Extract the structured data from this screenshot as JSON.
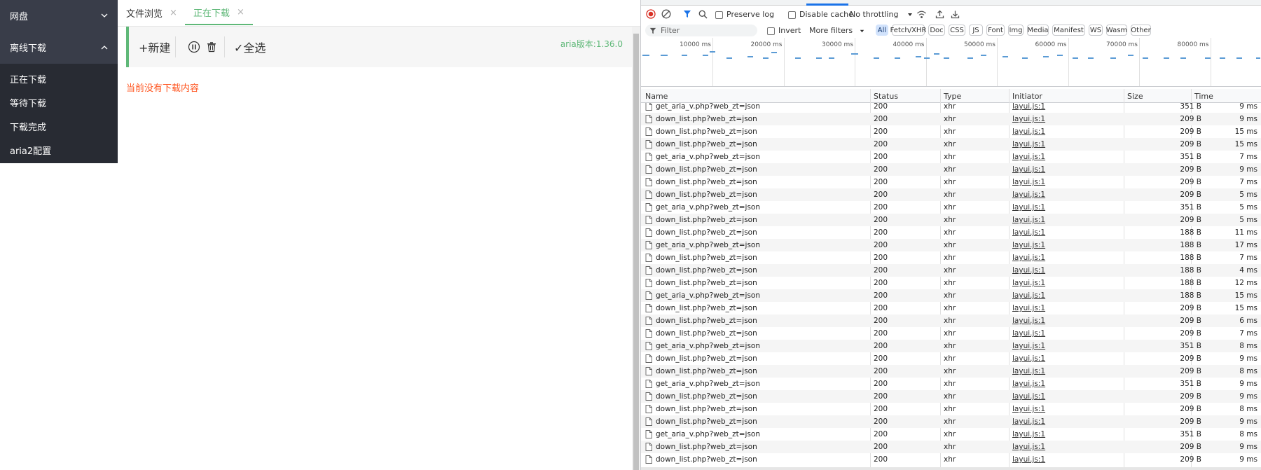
{
  "sidebar": {
    "items": [
      {
        "label": "网盘"
      },
      {
        "label": "离线下载"
      }
    ],
    "children": [
      {
        "label": "正在下载"
      },
      {
        "label": "等待下载"
      },
      {
        "label": "下载完成"
      },
      {
        "label": "aria2配置"
      }
    ]
  },
  "main": {
    "tabs": [
      {
        "label": "文件浏览",
        "close": "×"
      },
      {
        "label": "正在下载",
        "close": "×"
      }
    ],
    "toolbar": {
      "new_label": "+新建",
      "select_all_label": "✓全选",
      "aria_version": "aria版本:1.36.0"
    },
    "empty_message": "当前没有下载内容"
  },
  "devtools": {
    "preserve_log": "Preserve log",
    "disable_cache": "Disable cache",
    "throttling": "No throttling",
    "filter_placeholder": "Filter",
    "invert": "Invert",
    "more_filters": "More filters",
    "filter_types": [
      "All",
      "Fetch/XHR",
      "Doc",
      "CSS",
      "JS",
      "Font",
      "Img",
      "Media",
      "Manifest",
      "WS",
      "Wasm",
      "Other"
    ],
    "overview_ticks": [
      "10000 ms",
      "20000 ms",
      "30000 ms",
      "40000 ms",
      "50000 ms",
      "60000 ms",
      "70000 ms",
      "80000 ms"
    ],
    "columns": [
      "Name",
      "Status",
      "Type",
      "Initiator",
      "Size",
      "Time"
    ],
    "rows": [
      {
        "name": "get_aria_v.php?web_zt=json",
        "status": "200",
        "type": "xhr",
        "initiator": "layui.js:1",
        "size": "351 B",
        "time": "9 ms"
      },
      {
        "name": "down_list.php?web_zt=json",
        "status": "200",
        "type": "xhr",
        "initiator": "layui.js:1",
        "size": "209 B",
        "time": "9 ms"
      },
      {
        "name": "down_list.php?web_zt=json",
        "status": "200",
        "type": "xhr",
        "initiator": "layui.js:1",
        "size": "209 B",
        "time": "15 ms"
      },
      {
        "name": "down_list.php?web_zt=json",
        "status": "200",
        "type": "xhr",
        "initiator": "layui.js:1",
        "size": "209 B",
        "time": "15 ms"
      },
      {
        "name": "get_aria_v.php?web_zt=json",
        "status": "200",
        "type": "xhr",
        "initiator": "layui.js:1",
        "size": "351 B",
        "time": "7 ms"
      },
      {
        "name": "down_list.php?web_zt=json",
        "status": "200",
        "type": "xhr",
        "initiator": "layui.js:1",
        "size": "209 B",
        "time": "9 ms"
      },
      {
        "name": "down_list.php?web_zt=json",
        "status": "200",
        "type": "xhr",
        "initiator": "layui.js:1",
        "size": "209 B",
        "time": "7 ms"
      },
      {
        "name": "down_list.php?web_zt=json",
        "status": "200",
        "type": "xhr",
        "initiator": "layui.js:1",
        "size": "209 B",
        "time": "5 ms"
      },
      {
        "name": "get_aria_v.php?web_zt=json",
        "status": "200",
        "type": "xhr",
        "initiator": "layui.js:1",
        "size": "351 B",
        "time": "5 ms"
      },
      {
        "name": "down_list.php?web_zt=json",
        "status": "200",
        "type": "xhr",
        "initiator": "layui.js:1",
        "size": "209 B",
        "time": "5 ms"
      },
      {
        "name": "down_list.php?web_zt=json",
        "status": "200",
        "type": "xhr",
        "initiator": "layui.js:1",
        "size": "188 B",
        "time": "11 ms"
      },
      {
        "name": "get_aria_v.php?web_zt=json",
        "status": "200",
        "type": "xhr",
        "initiator": "layui.js:1",
        "size": "188 B",
        "time": "17 ms"
      },
      {
        "name": "down_list.php?web_zt=json",
        "status": "200",
        "type": "xhr",
        "initiator": "layui.js:1",
        "size": "188 B",
        "time": "7 ms"
      },
      {
        "name": "down_list.php?web_zt=json",
        "status": "200",
        "type": "xhr",
        "initiator": "layui.js:1",
        "size": "188 B",
        "time": "4 ms"
      },
      {
        "name": "down_list.php?web_zt=json",
        "status": "200",
        "type": "xhr",
        "initiator": "layui.js:1",
        "size": "188 B",
        "time": "12 ms"
      },
      {
        "name": "get_aria_v.php?web_zt=json",
        "status": "200",
        "type": "xhr",
        "initiator": "layui.js:1",
        "size": "188 B",
        "time": "15 ms"
      },
      {
        "name": "down_list.php?web_zt=json",
        "status": "200",
        "type": "xhr",
        "initiator": "layui.js:1",
        "size": "209 B",
        "time": "15 ms"
      },
      {
        "name": "down_list.php?web_zt=json",
        "status": "200",
        "type": "xhr",
        "initiator": "layui.js:1",
        "size": "209 B",
        "time": "6 ms"
      },
      {
        "name": "down_list.php?web_zt=json",
        "status": "200",
        "type": "xhr",
        "initiator": "layui.js:1",
        "size": "209 B",
        "time": "7 ms"
      },
      {
        "name": "get_aria_v.php?web_zt=json",
        "status": "200",
        "type": "xhr",
        "initiator": "layui.js:1",
        "size": "351 B",
        "time": "8 ms"
      },
      {
        "name": "down_list.php?web_zt=json",
        "status": "200",
        "type": "xhr",
        "initiator": "layui.js:1",
        "size": "209 B",
        "time": "9 ms"
      },
      {
        "name": "down_list.php?web_zt=json",
        "status": "200",
        "type": "xhr",
        "initiator": "layui.js:1",
        "size": "209 B",
        "time": "8 ms"
      },
      {
        "name": "get_aria_v.php?web_zt=json",
        "status": "200",
        "type": "xhr",
        "initiator": "layui.js:1",
        "size": "351 B",
        "time": "9 ms"
      },
      {
        "name": "down_list.php?web_zt=json",
        "status": "200",
        "type": "xhr",
        "initiator": "layui.js:1",
        "size": "209 B",
        "time": "9 ms"
      },
      {
        "name": "down_list.php?web_zt=json",
        "status": "200",
        "type": "xhr",
        "initiator": "layui.js:1",
        "size": "209 B",
        "time": "8 ms"
      },
      {
        "name": "down_list.php?web_zt=json",
        "status": "200",
        "type": "xhr",
        "initiator": "layui.js:1",
        "size": "209 B",
        "time": "9 ms"
      },
      {
        "name": "get_aria_v.php?web_zt=json",
        "status": "200",
        "type": "xhr",
        "initiator": "layui.js:1",
        "size": "351 B",
        "time": "8 ms"
      },
      {
        "name": "down_list.php?web_zt=json",
        "status": "200",
        "type": "xhr",
        "initiator": "layui.js:1",
        "size": "209 B",
        "time": "9 ms"
      },
      {
        "name": "down_list.php?web_zt=json",
        "status": "200",
        "type": "xhr",
        "initiator": "layui.js:1",
        "size": "209 B",
        "time": "9 ms"
      }
    ]
  },
  "colors": {
    "accent": "#5fb878",
    "sidebar_bg": "#393d49",
    "sidebar_child_bg": "#282b33",
    "empty_text": "#ff5722",
    "record_red": "#d93025",
    "devtools_blue": "#1a73e8"
  }
}
